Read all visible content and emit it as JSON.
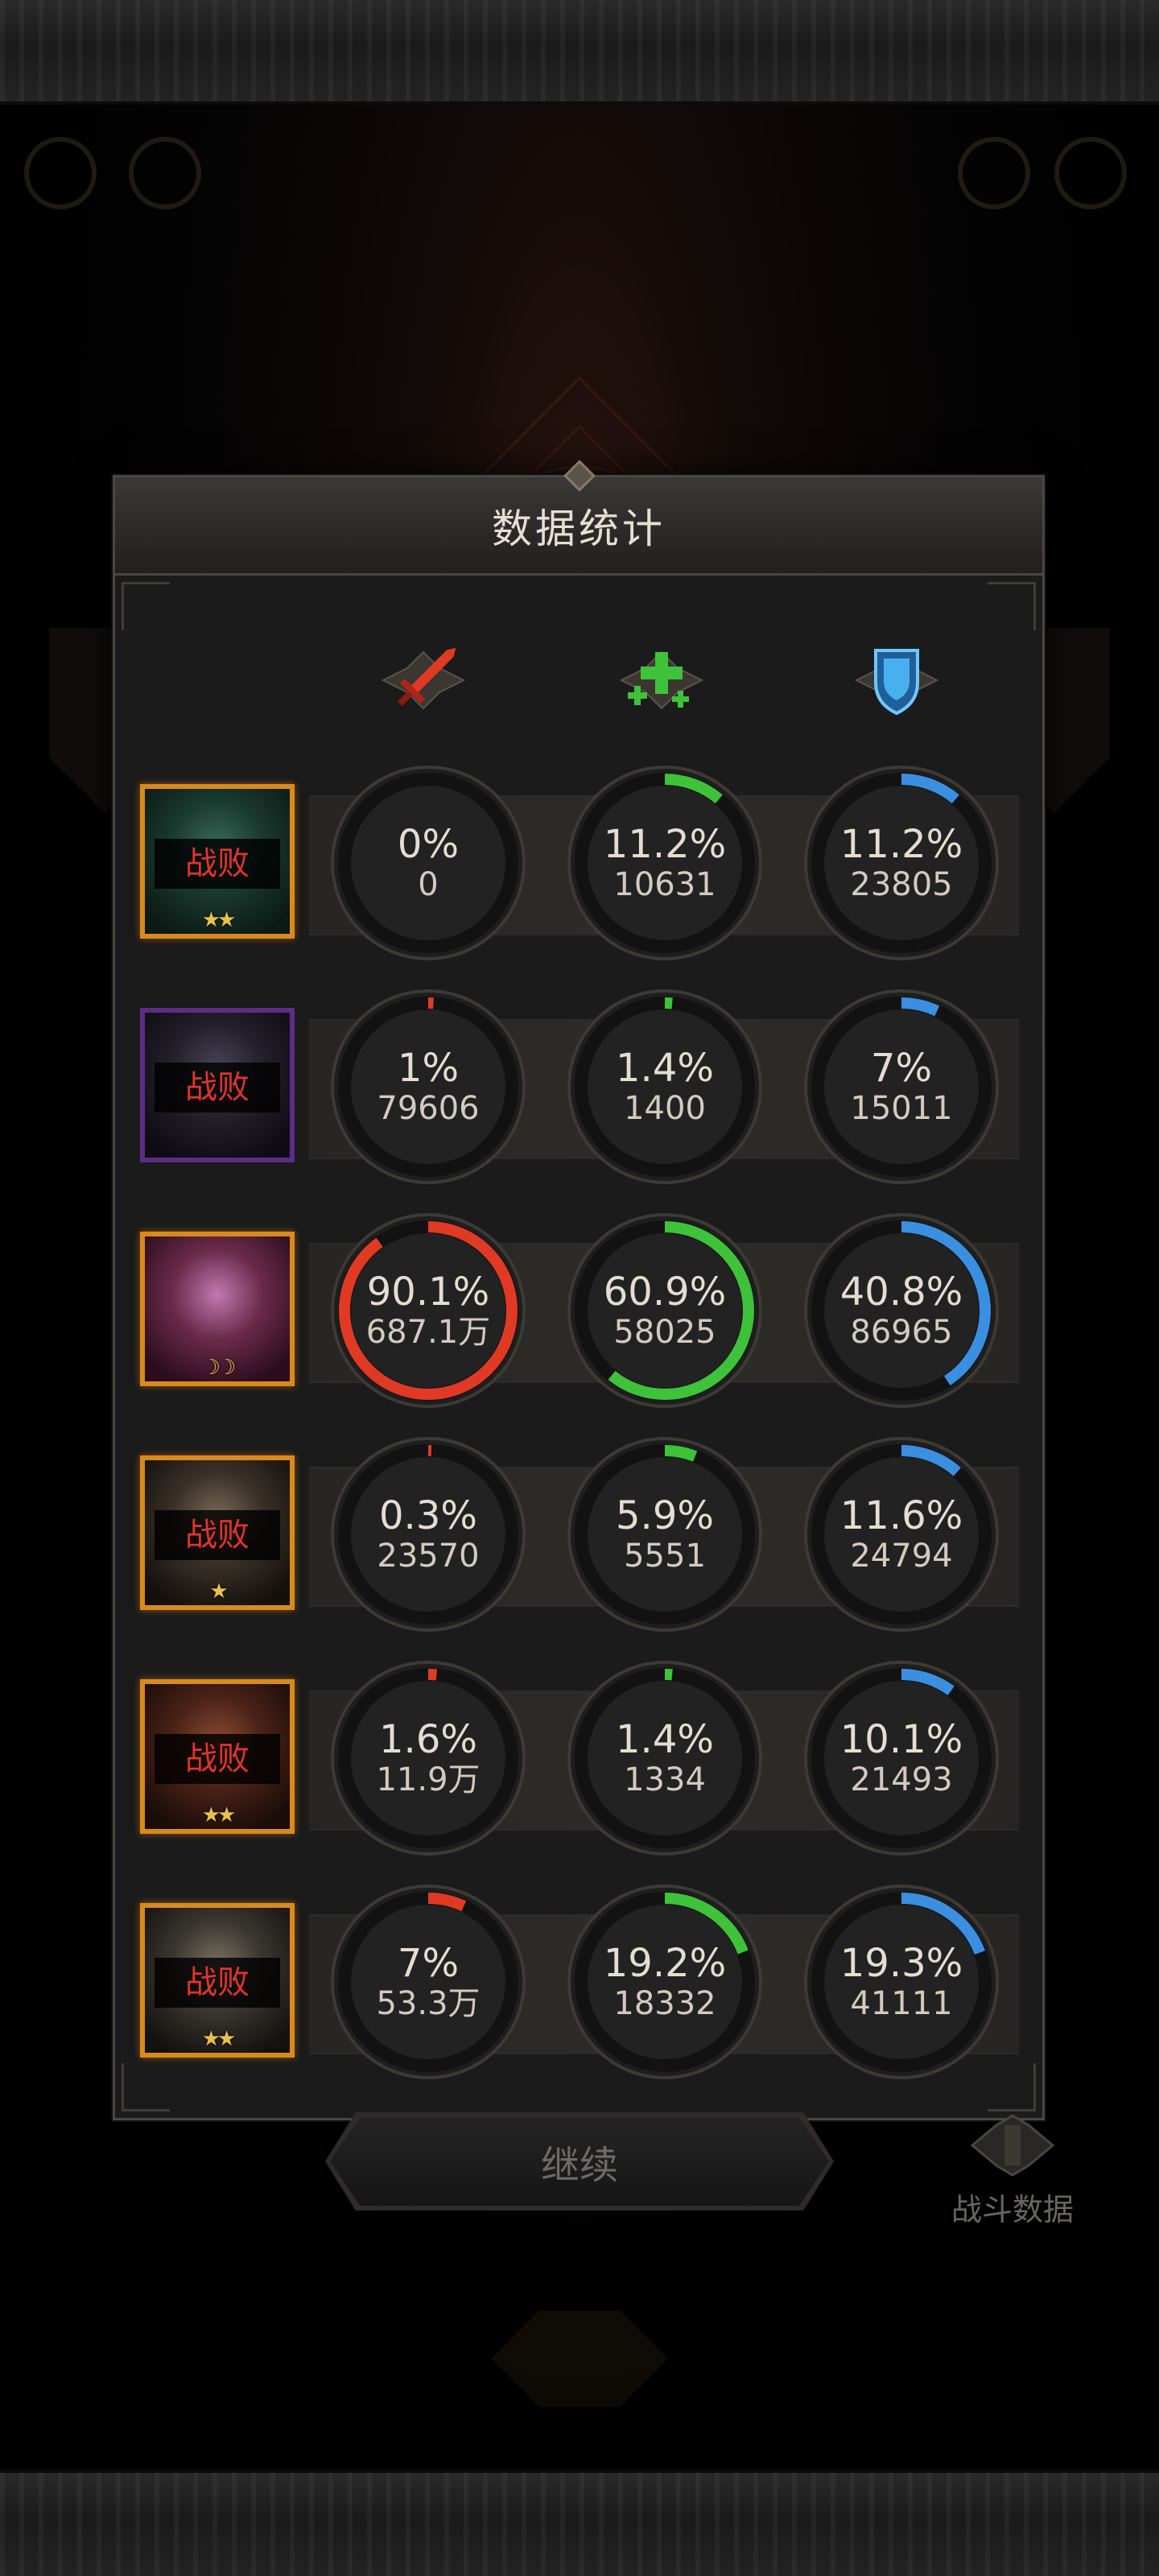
{
  "title": "数据统计",
  "columns": [
    {
      "icon": "red-sword-icon",
      "color": "#e03a24"
    },
    {
      "icon": "green-heal-cross-icon",
      "color": "#3ec23a"
    },
    {
      "icon": "blue-shield-icon",
      "color": "#3b8fe0"
    }
  ],
  "defeat_label": "战败",
  "rows": [
    {
      "defeated": true,
      "stars": "★★",
      "frame": "gold",
      "stats": [
        {
          "pct": "0%",
          "value": "0",
          "frac": 0
        },
        {
          "pct": "11.2%",
          "value": "10631",
          "frac": 0.112
        },
        {
          "pct": "11.2%",
          "value": "23805",
          "frac": 0.112
        }
      ]
    },
    {
      "defeated": true,
      "stars": "",
      "frame": "purple",
      "stats": [
        {
          "pct": "1%",
          "value": "79606",
          "frac": 0.01
        },
        {
          "pct": "1.4%",
          "value": "1400",
          "frac": 0.014
        },
        {
          "pct": "7%",
          "value": "15011",
          "frac": 0.07
        }
      ]
    },
    {
      "defeated": false,
      "stars": "☽☽",
      "frame": "gold",
      "stats": [
        {
          "pct": "90.1%",
          "value": "687.1万",
          "frac": 0.901
        },
        {
          "pct": "60.9%",
          "value": "58025",
          "frac": 0.609
        },
        {
          "pct": "40.8%",
          "value": "86965",
          "frac": 0.408
        }
      ]
    },
    {
      "defeated": true,
      "stars": "★",
      "frame": "gold",
      "stats": [
        {
          "pct": "0.3%",
          "value": "23570",
          "frac": 0.003
        },
        {
          "pct": "5.9%",
          "value": "5551",
          "frac": 0.059
        },
        {
          "pct": "11.6%",
          "value": "24794",
          "frac": 0.116
        }
      ]
    },
    {
      "defeated": true,
      "stars": "★★",
      "frame": "gold",
      "stats": [
        {
          "pct": "1.6%",
          "value": "11.9万",
          "frac": 0.016
        },
        {
          "pct": "1.4%",
          "value": "1334",
          "frac": 0.014
        },
        {
          "pct": "10.1%",
          "value": "21493",
          "frac": 0.101
        }
      ]
    },
    {
      "defeated": true,
      "stars": "★★",
      "frame": "gold",
      "stats": [
        {
          "pct": "7%",
          "value": "53.3万",
          "frac": 0.07
        },
        {
          "pct": "19.2%",
          "value": "18332",
          "frac": 0.192
        },
        {
          "pct": "19.3%",
          "value": "41111",
          "frac": 0.193
        }
      ]
    }
  ],
  "continue_label": "继续",
  "battle_data_label": "战斗数据"
}
